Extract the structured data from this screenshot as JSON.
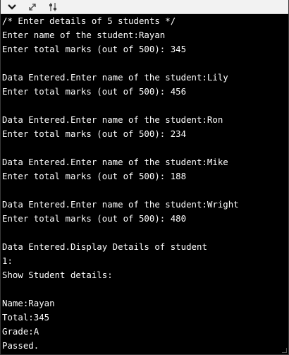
{
  "toolbar": {
    "buttons": [
      {
        "name": "collapse-icon"
      },
      {
        "name": "expand-icon"
      },
      {
        "name": "sliders-icon"
      }
    ]
  },
  "console": {
    "lines": [
      "/* Enter details of 5 students */",
      "Enter name of the student:Rayan",
      "Enter total marks (out of 500): 345",
      "",
      "Data Entered.Enter name of the student:Lily",
      "Enter total marks (out of 500): 456",
      "",
      "Data Entered.Enter name of the student:Ron",
      "Enter total marks (out of 500): 234",
      "",
      "Data Entered.Enter name of the student:Mike",
      "Enter total marks (out of 500): 188",
      "",
      "Data Entered.Enter name of the student:Wright",
      "Enter total marks (out of 500): 480",
      "",
      "Data Entered.Display Details of student",
      "1:",
      "Show Student details:",
      "",
      "Name:Rayan",
      "Total:345",
      "Grade:A",
      "Passed."
    ]
  }
}
